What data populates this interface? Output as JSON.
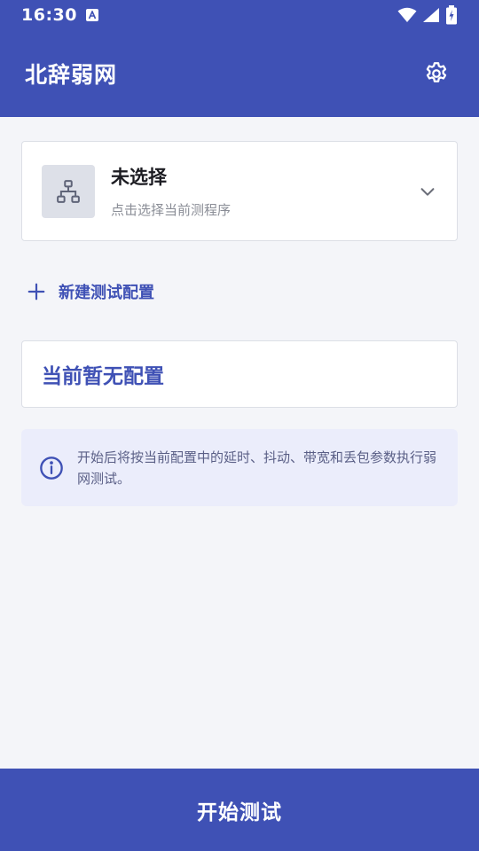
{
  "status_bar": {
    "time": "16:30",
    "icons": [
      "a-icon",
      "wifi-icon",
      "signal-icon",
      "battery-charging-icon"
    ]
  },
  "app_bar": {
    "title": "北辞弱网",
    "settings_icon": "gear-icon"
  },
  "program_selector": {
    "icon": "network-hierarchy-icon",
    "title": "未选择",
    "subtitle": "点击选择当前测程序",
    "chevron": "chevron-down-icon"
  },
  "new_config": {
    "icon": "plus-icon",
    "label": "新建测试配置"
  },
  "current_config": {
    "empty_text": "当前暂无配置"
  },
  "info": {
    "icon": "info-icon",
    "text": "开始后将按当前配置中的延时、抖动、带宽和丢包参数执行弱网测试。"
  },
  "start_button": {
    "label": "开始测试"
  },
  "colors": {
    "brand": "#3f51b5",
    "background": "#f4f5f9",
    "info_background": "#ebedfb"
  }
}
